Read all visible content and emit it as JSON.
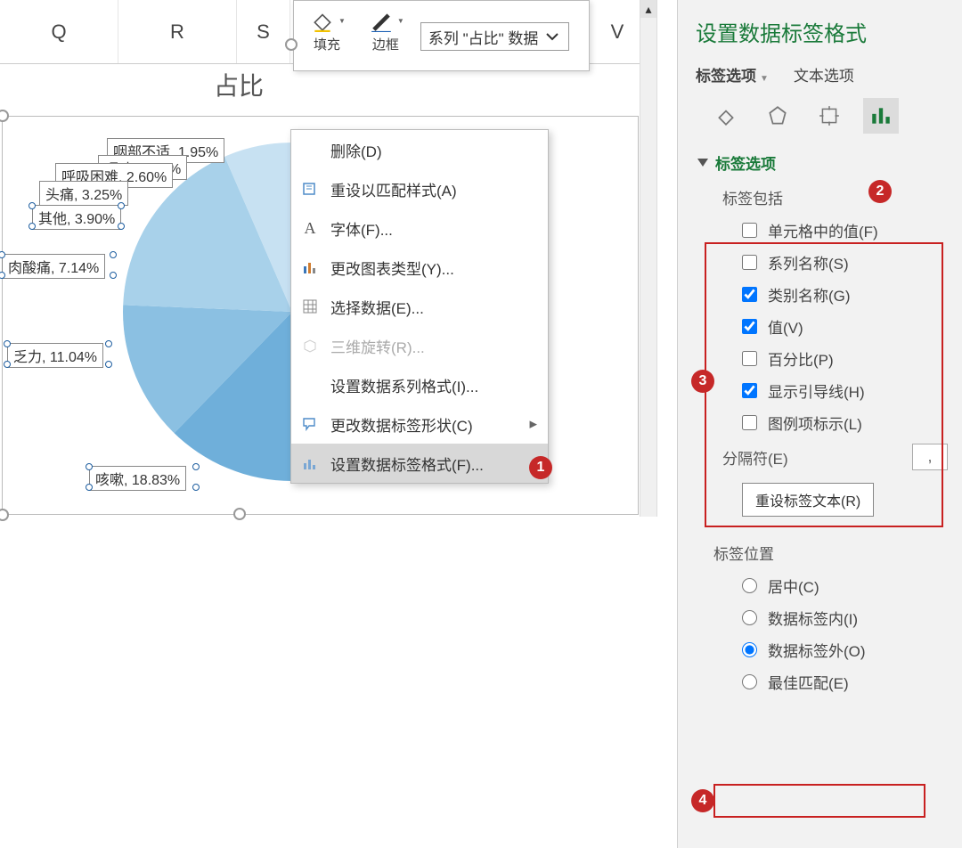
{
  "columns": [
    "Q",
    "R",
    "S",
    "",
    "",
    "V"
  ],
  "mini_toolbar": {
    "fill_label": "填充",
    "border_label": "边框",
    "series_selector": "系列 \"占比\" 数据"
  },
  "chart": {
    "title": "占比"
  },
  "chart_data": {
    "type": "pie",
    "title": "占比",
    "series": [
      {
        "name": "占比",
        "categories": [
          "咽部不适",
          "呕吐",
          "呼吸困难",
          "头痛",
          "其他",
          "肉酸痛",
          "乏力",
          "咳嗽"
        ],
        "values": [
          1.95,
          2.6,
          2.6,
          3.25,
          3.9,
          7.14,
          11.04,
          18.83
        ]
      }
    ],
    "labels_visible": [
      "咽部不适, 1.95%",
      "呕吐, 2.60%",
      "呼吸困难, 2.60%",
      "头痛, 3.25%",
      "其他, 3.90%",
      "肉酸痛, 7.14%",
      "乏力, 11.04%",
      "咳嗽, 18.83%"
    ]
  },
  "labels": {
    "l0": "咽部不适, 1.95%",
    "l1": "呕吐, 2.60%",
    "l2": "呼吸困难, 2.60%",
    "l3": "头痛, 3.25%",
    "l4": "其他, 3.90%",
    "l5": "肉酸痛, 7.14%",
    "l6": "乏力, 11.04%",
    "l7": "咳嗽, 18.83%"
  },
  "context_menu": {
    "delete": "删除(D)",
    "reset_style": "重设以匹配样式(A)",
    "font": "字体(F)...",
    "change_chart_type": "更改图表类型(Y)...",
    "select_data": "选择数据(E)...",
    "rotate_3d": "三维旋转(R)...",
    "format_series": "设置数据系列格式(I)...",
    "change_label_shape": "更改数据标签形状(C)",
    "format_labels": "设置数据标签格式(F)..."
  },
  "right_panel": {
    "title": "设置数据标签格式",
    "tab_label_options": "标签选项",
    "tab_text_options": "文本选项",
    "section_label_options": "标签选项",
    "label_includes": "标签包括",
    "chk_cell_value": "单元格中的值(F)",
    "chk_series_name": "系列名称(S)",
    "chk_category_name": "类别名称(G)",
    "chk_value": "值(V)",
    "chk_percentage": "百分比(P)",
    "chk_leader_lines": "显示引导线(H)",
    "chk_legend_key": "图例项标示(L)",
    "separator": "分隔符(E)",
    "separator_value": ",",
    "reset_label_text": "重设标签文本(R)",
    "label_position": "标签位置",
    "pos_center": "居中(C)",
    "pos_inside": "数据标签内(I)",
    "pos_outside": "数据标签外(O)",
    "pos_best_fit": "最佳匹配(E)"
  },
  "callouts": {
    "c1": "1",
    "c2": "2",
    "c3": "3",
    "c4": "4"
  }
}
